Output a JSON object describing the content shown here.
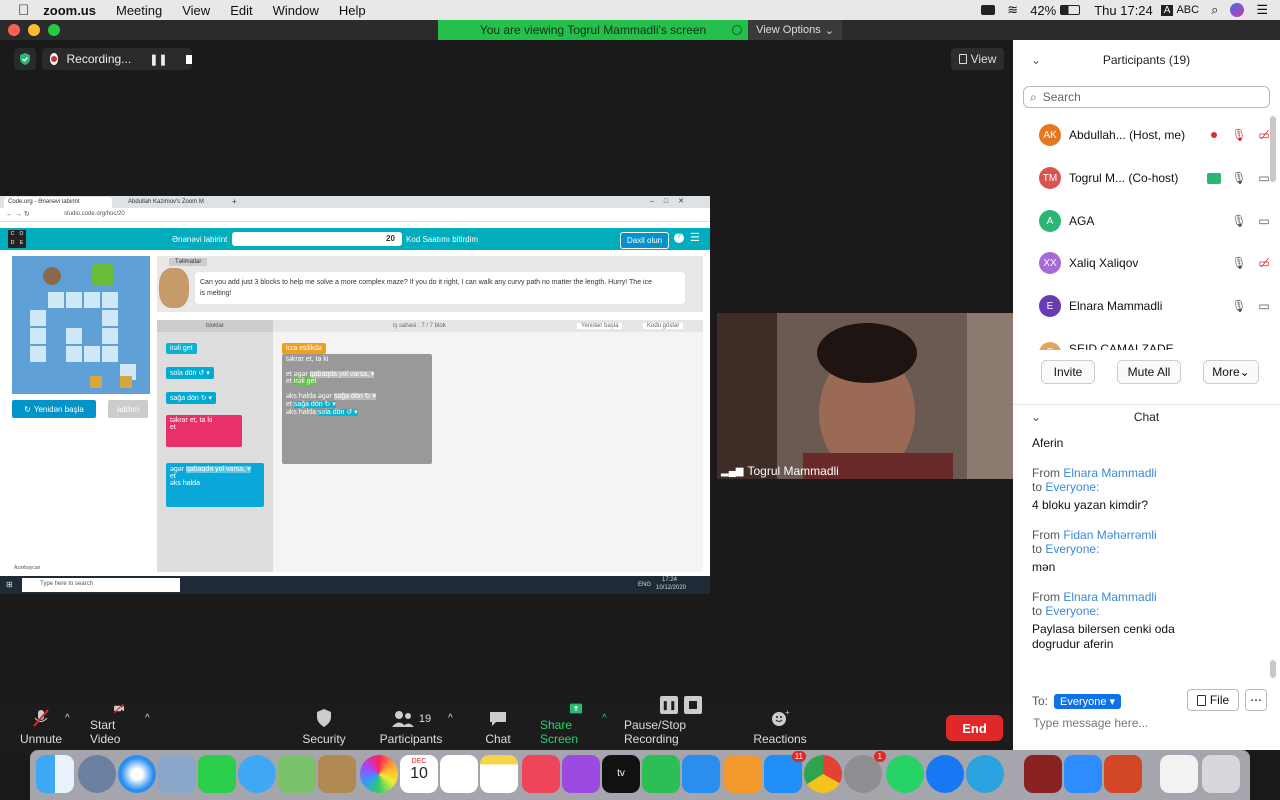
{
  "menubar": {
    "app": "zoom.us",
    "items": [
      "Meeting",
      "View",
      "Edit",
      "Window",
      "Help"
    ],
    "battery": "42%",
    "clock": "Thu 17:24",
    "input_source": "ABC"
  },
  "share_banner": "You are viewing Togrul Mammadli's screen",
  "view_options": "View Options",
  "recording_label": "Recording...",
  "view_button": "View",
  "shared_screen": {
    "url": "studio.code.org/hoc/20",
    "tab1": "Code.org - Ənənəvi labirint",
    "tab2": "Abdullah Kazimov's Zoom M",
    "header_title": "Ənənəvi labirint",
    "progress_number": "20",
    "header_link": "Kod Saatımı bitirdim",
    "signin": "Daxil olun",
    "instructions_label": "Təlimatlar",
    "instructions": "Can you add just 3 blocks to help me solve a more complex maze? If you do it right, I can walk any curvy path no matter the length. Hurry! The ice is melting!",
    "toolbox_label": "bloklar",
    "workspace_label": "iş sahəsi : 7 / 7 blok",
    "reset_ws": "Yenidən başla",
    "show_code": "Kodu göstər",
    "reset_btn": "Yenidən başla",
    "step_btn": "addım",
    "language": "Azərbaycan",
    "taskbar_search": "Type here to search",
    "taskbar_time": "17:24",
    "taskbar_date": "10/12/2020",
    "taskbar_lang": "ENG",
    "blocks": {
      "forward": "irəli get",
      "left": "sola dön ↺ ▾",
      "right": "sağa dön ↻ ▾",
      "repeat": "təkrar et, ta ki",
      "do": "et",
      "if": "əgər",
      "path": "qabaqda yol varsa, ▾",
      "else": "əks halda",
      "on_run": "icra etdikdə"
    }
  },
  "video": {
    "name": "Togrul Mammadli"
  },
  "toolbar": {
    "unmute": "Unmute",
    "start_video": "Start Video",
    "security": "Security",
    "participants": "Participants",
    "participants_count": "19",
    "chat": "Chat",
    "share_screen": "Share Screen",
    "recording": "Pause/Stop Recording",
    "reactions": "Reactions",
    "end": "End"
  },
  "panel": {
    "title": "Participants (19)",
    "search_placeholder": "Search",
    "participants": [
      {
        "initials": "AK",
        "name": "Abdullah...",
        "role": "(Host, me)",
        "color": "#e5771e"
      },
      {
        "initials": "TM",
        "name": "Togrul M...",
        "role": "(Co-host)",
        "color": "#d9534f"
      },
      {
        "initials": "A",
        "name": "AGA",
        "role": "",
        "color": "#2bb673"
      },
      {
        "initials": "XX",
        "name": "Xaliq Xaliqov",
        "role": "",
        "color": "#a66bd6"
      },
      {
        "initials": "E",
        "name": "Elnara Mammadli",
        "role": "",
        "color": "#6a3ab5"
      },
      {
        "initials": "S",
        "name": "SEID CAMALZADE",
        "role": "",
        "color": "#e3a35a"
      }
    ],
    "invite": "Invite",
    "mute_all": "Mute All",
    "more": "More"
  },
  "chat": {
    "title": "Chat",
    "first": "Aferin",
    "messages": [
      {
        "from": "From",
        "sender": "Elnara Mammadli",
        "to": "to",
        "target": "Everyone:",
        "text": "4 bloku yazan kimdir?"
      },
      {
        "from": "From",
        "sender": "Fidan Məhərrəmli",
        "to": "to",
        "target": "Everyone:",
        "text": "mən"
      },
      {
        "from": "From",
        "sender": "Elnara Mammadli",
        "to": "to",
        "target": "Everyone:",
        "text": "Paylasa bilersen cenki oda dogrudur aferin"
      }
    ],
    "to_label": "To:",
    "to_value": "Everyone",
    "file": "File",
    "placeholder": "Type message here..."
  },
  "dock": {
    "calendar_month": "DEC",
    "calendar_day": "10",
    "appstore_badge": "11",
    "prefs_badge": "1"
  }
}
